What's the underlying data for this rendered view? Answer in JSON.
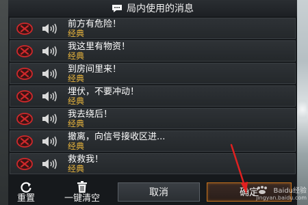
{
  "header": {
    "title": "局内使用的消息",
    "icon": "message-icon"
  },
  "messages": [
    {
      "text": "前方有危险！",
      "tag": "经典"
    },
    {
      "text": "我这里有物资！",
      "tag": "经典"
    },
    {
      "text": "到房间里来！",
      "tag": "经典"
    },
    {
      "text": "埋伏，不要冲动！",
      "tag": "经典"
    },
    {
      "text": "我去绕后！",
      "tag": "经典"
    },
    {
      "text": "撤离，向信号接收区进...",
      "tag": "经典"
    },
    {
      "text": "救救我！",
      "tag": "经典"
    }
  ],
  "footer": {
    "reset_label": "重置",
    "clear_label": "一键清空",
    "cancel_label": "取消",
    "confirm_label": "确定"
  },
  "watermark": {
    "brand": "Baidu经验",
    "url": "jingyan.baidu.com"
  },
  "colors": {
    "tag": "#e7b43d",
    "confirm_border": "#c9731c",
    "delete_icon": "#d0282b",
    "arrow": "#e02020"
  }
}
